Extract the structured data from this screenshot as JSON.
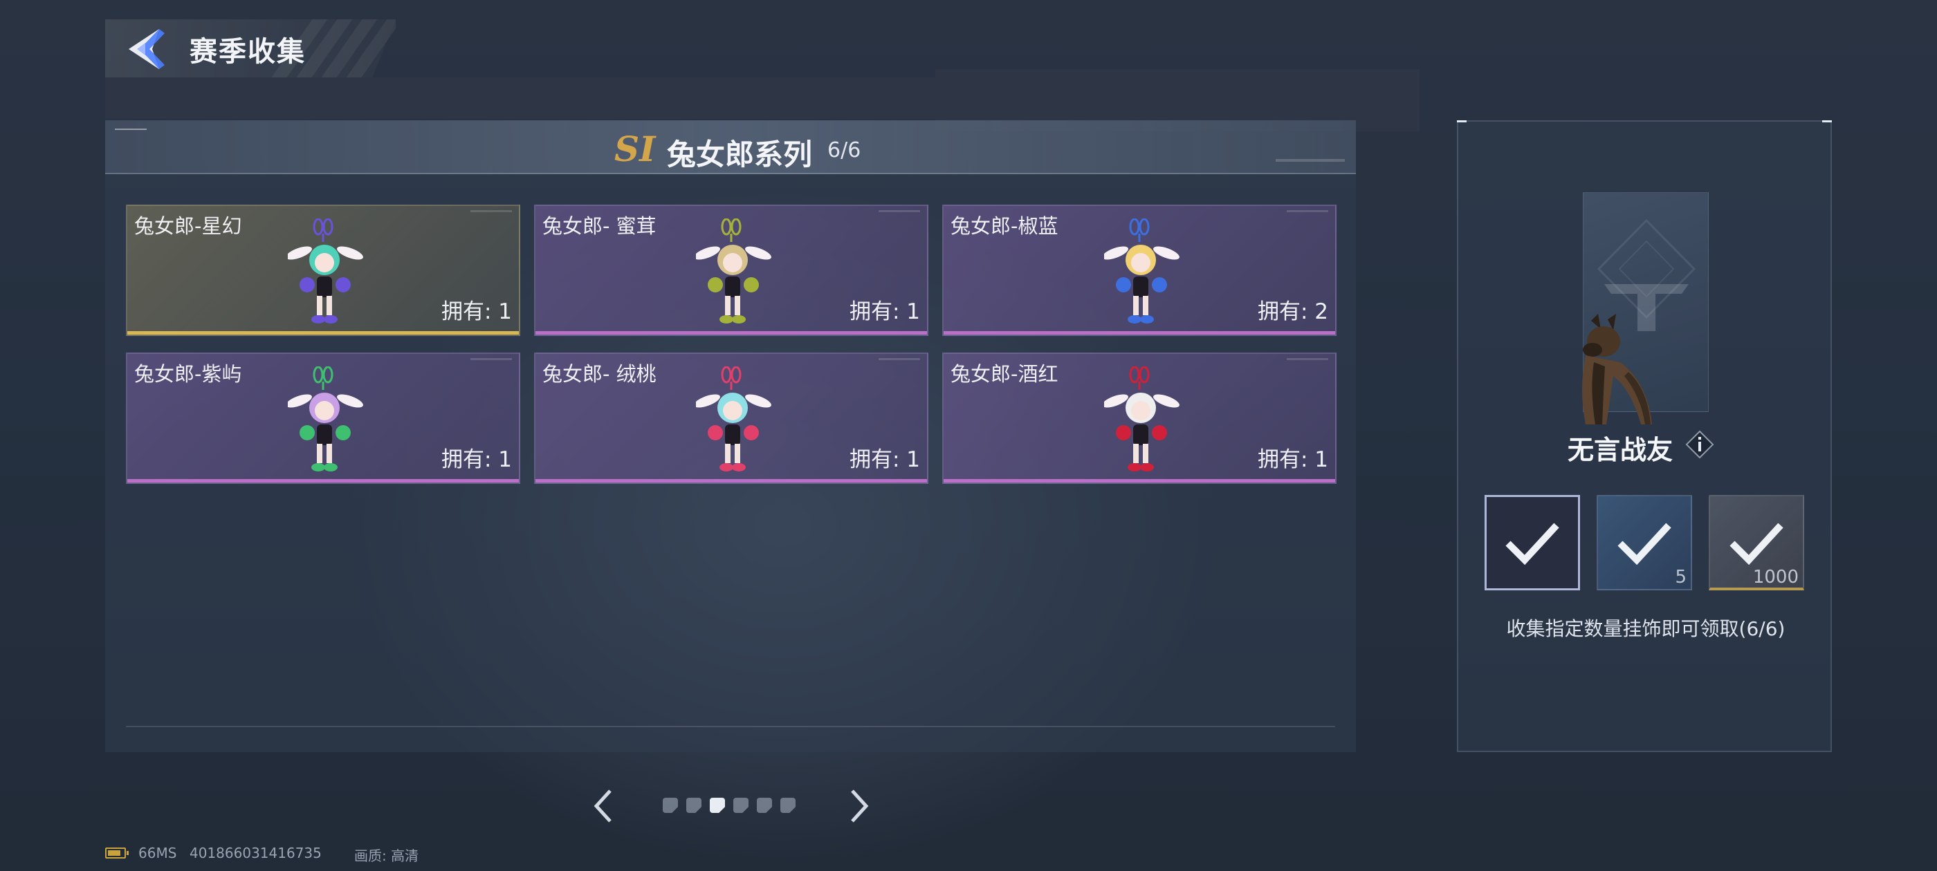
{
  "header": {
    "title": "赛季收集"
  },
  "series": {
    "badge": "SI",
    "title": "兔女郎系列",
    "count": "6/6"
  },
  "cards": [
    {
      "name": "兔女郎-星幻",
      "owned": "拥有: 1",
      "tier": "gold",
      "hair": "#4fd0b8",
      "accent": "#6a53d8"
    },
    {
      "name": "兔女郎- 蜜茸",
      "owned": "拥有: 1",
      "tier": "purple",
      "hair": "#d6c28a",
      "accent": "#a5b23a"
    },
    {
      "name": "兔女郎-椒蓝",
      "owned": "拥有: 2",
      "tier": "purple",
      "hair": "#f0d070",
      "accent": "#3d6fe0"
    },
    {
      "name": "兔女郎-紫屿",
      "owned": "拥有: 1",
      "tier": "purple",
      "hair": "#c9a0e6",
      "accent": "#3fbf70"
    },
    {
      "name": "兔女郎- 绒桃",
      "owned": "拥有: 1",
      "tier": "purple",
      "hair": "#8fe0e6",
      "accent": "#e0406a"
    },
    {
      "name": "兔女郎-酒红",
      "owned": "拥有: 1",
      "tier": "purple",
      "hair": "#eeeeee",
      "accent": "#d0203a"
    }
  ],
  "pagination": {
    "total": 6,
    "active_index": 2
  },
  "footer": {
    "ping": "66MS",
    "player_id": "401866031416735",
    "quality": "画质: 高清"
  },
  "reward": {
    "name": "无言战友",
    "info_icon": "info-icon",
    "slots": [
      {
        "icon": "check-icon",
        "qty": ""
      },
      {
        "icon": "check-icon",
        "qty": "5"
      },
      {
        "icon": "check-icon",
        "qty": "1000"
      }
    ],
    "description": "收集指定数量挂饰即可领取(6/6)"
  },
  "colors": {
    "gold_line": "#d8b755",
    "purple_line": "#b970c6",
    "badge_gold": "#d3a64c"
  }
}
